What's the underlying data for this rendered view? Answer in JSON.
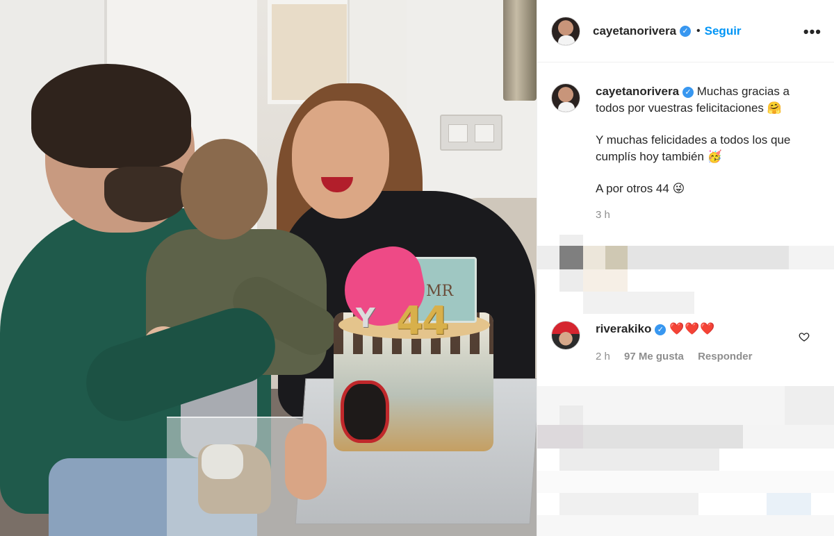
{
  "header": {
    "username": "cayetanorivera",
    "separator": "•",
    "follow_label": "Seguir",
    "more_label": "•••"
  },
  "caption": {
    "username": "cayetanorivera",
    "line1": "Muchas gracias a todos por vuestras felicitaciones 🤗",
    "line2": "Y muchas felicidades a todos los que cumplís hoy también 🥳",
    "line3": "A por otros 44 😜",
    "time": "3 h"
  },
  "photo": {
    "cake_number": "44",
    "cake_letter": "Y",
    "book_text": "MR"
  },
  "comment": {
    "username": "riverakiko",
    "text": "❤️❤️❤️",
    "time": "2 h",
    "likes": "97 Me gusta",
    "reply": "Responder"
  },
  "icons": {
    "verified": "verified-badge-icon",
    "like": "heart-outline-icon",
    "more": "more-options-icon"
  },
  "colors": {
    "link_blue": "#0095f6",
    "verified_blue": "#3897f0",
    "heart_red": "#e0162b",
    "meta_gray": "#8e8e8e"
  }
}
